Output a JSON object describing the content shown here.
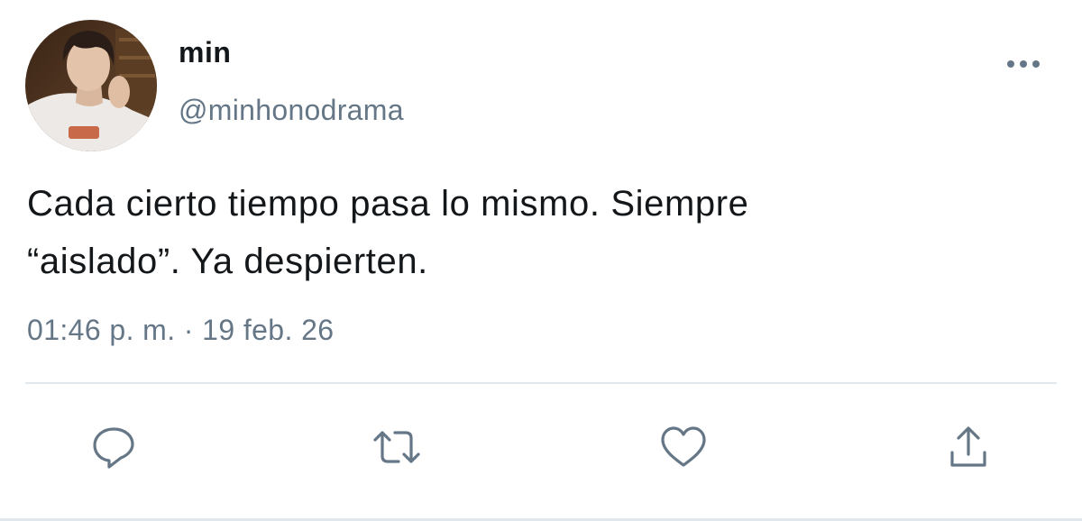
{
  "user": {
    "display_name": "min",
    "handle": "@minhonodrama"
  },
  "tweet": {
    "text_line1": "Cada cierto tiempo pasa lo mismo. Siempre",
    "text_line2": "“aislado”. Ya despierten.",
    "timestamp": "01:46 p. m. · 19 feb. 26"
  },
  "actions": {
    "icons": [
      "reply-icon",
      "retweet-icon",
      "like-icon",
      "share-icon"
    ]
  },
  "colors": {
    "text_primary": "#14171a",
    "text_secondary": "#657786",
    "divider": "#e1e8ed"
  }
}
